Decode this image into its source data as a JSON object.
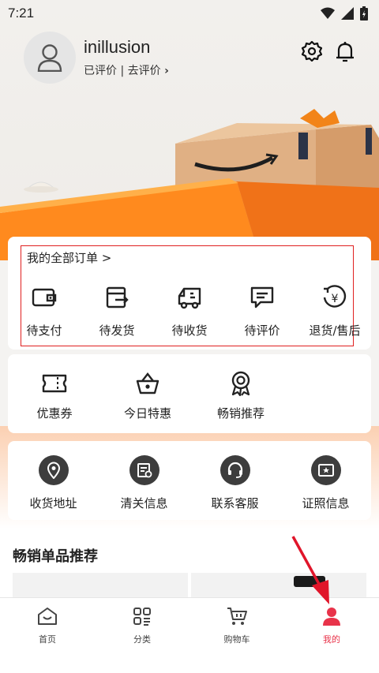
{
  "status": {
    "time": "7:21"
  },
  "user": {
    "name": "inillusion",
    "reviewed": "已评价",
    "separator": "|",
    "to_review": "去评价",
    "chevron": "›"
  },
  "orders": {
    "title": "我的全部订单 >",
    "items": [
      {
        "label": "待支付",
        "icon": "wallet-icon"
      },
      {
        "label": "待发货",
        "icon": "box-export-icon"
      },
      {
        "label": "待收货",
        "icon": "truck-icon"
      },
      {
        "label": "待评价",
        "icon": "comment-icon"
      },
      {
        "label": "退货/售后",
        "icon": "refund-yen-icon"
      }
    ]
  },
  "deals": {
    "items": [
      {
        "label": "优惠券",
        "icon": "coupon-ticket-icon"
      },
      {
        "label": "今日特惠",
        "icon": "basket-icon"
      },
      {
        "label": "畅销推荐",
        "icon": "award-ribbon-icon"
      }
    ]
  },
  "services": {
    "items": [
      {
        "label": "收货地址",
        "icon": "location-pin-icon"
      },
      {
        "label": "清关信息",
        "icon": "customs-doc-icon"
      },
      {
        "label": "联系客服",
        "icon": "headset-icon"
      },
      {
        "label": "证照信息",
        "icon": "license-star-icon"
      }
    ]
  },
  "recommend": {
    "title": "畅销单品推荐"
  },
  "tabs": [
    {
      "label": "首页",
      "icon": "home-icon"
    },
    {
      "label": "分类",
      "icon": "category-icon"
    },
    {
      "label": "购物车",
      "icon": "cart-icon"
    },
    {
      "label": "我的",
      "icon": "profile-icon"
    }
  ],
  "colors": {
    "accent": "#e8334a",
    "orange": "#ff7a1a",
    "highlight": "#e02020",
    "arrow": "#e0152a"
  }
}
